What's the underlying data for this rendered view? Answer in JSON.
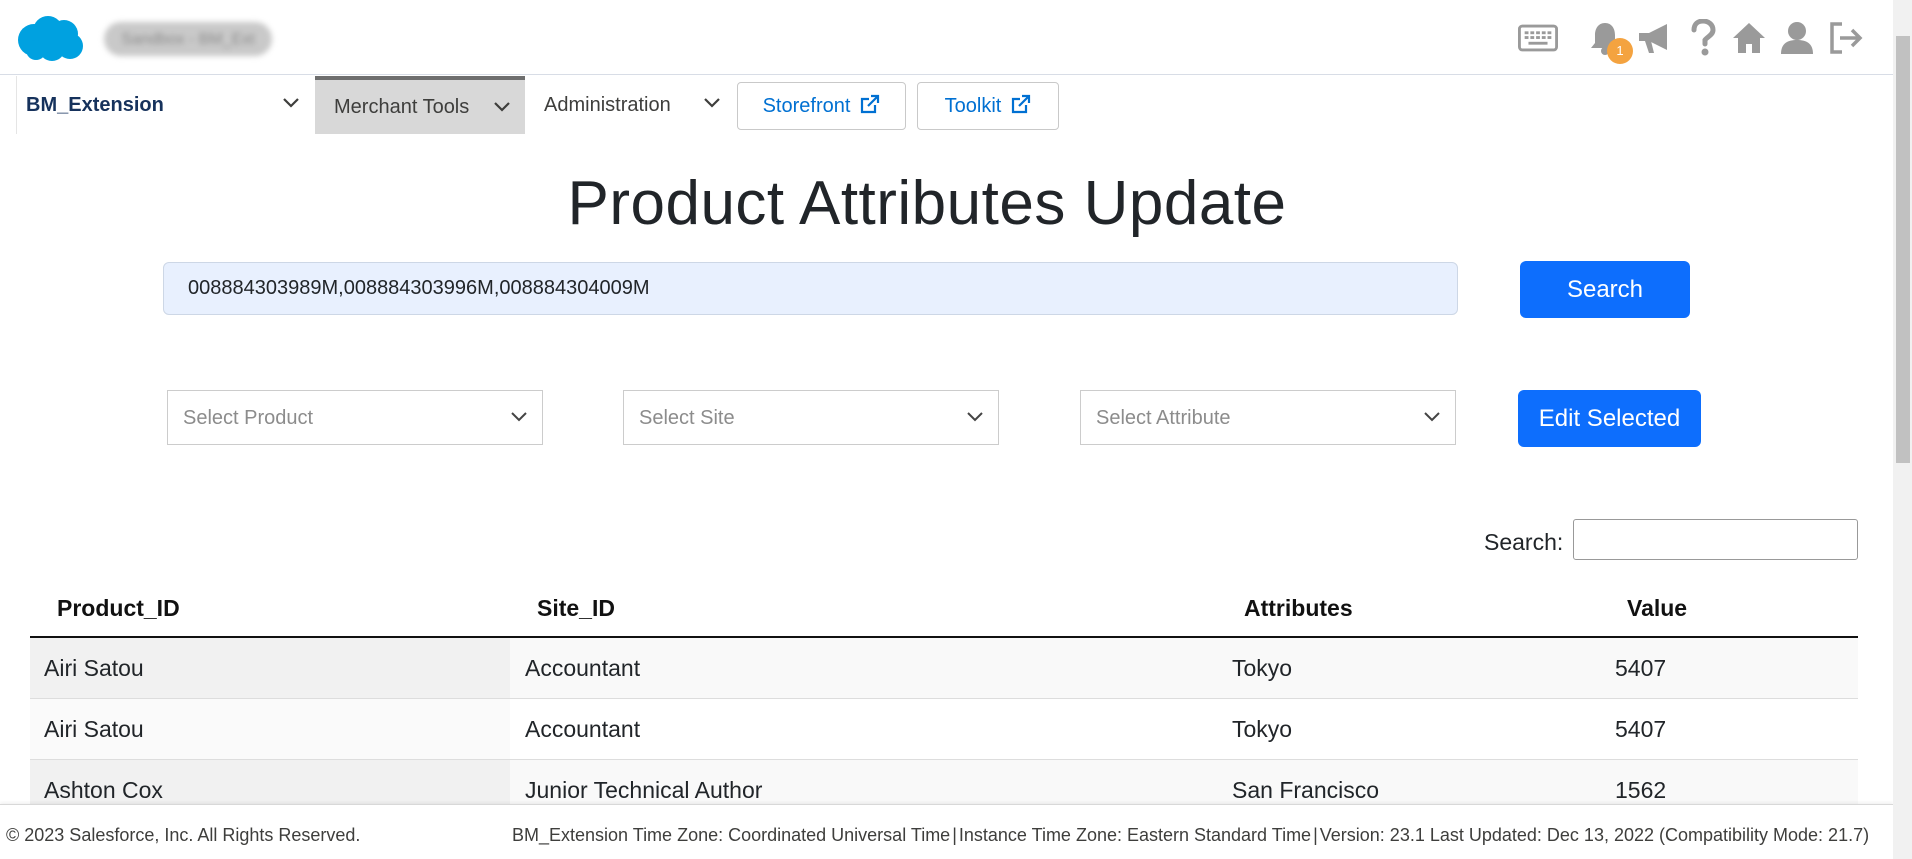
{
  "header": {
    "org_name": "Sandbox - BM_Ext",
    "notification_count": "1",
    "icons": [
      "salesforce-cloud-logo",
      "keyboard-icon",
      "bell-icon",
      "megaphone-icon",
      "help-icon",
      "home-icon",
      "user-icon",
      "logout-icon"
    ]
  },
  "nav": {
    "site_selector": "BM_Extension",
    "tabs": [
      {
        "label": "Merchant Tools",
        "active": true
      },
      {
        "label": "Administration",
        "active": false
      }
    ],
    "buttons": [
      {
        "label": "Storefront"
      },
      {
        "label": "Toolkit"
      }
    ]
  },
  "main": {
    "title": "Product Attributes Update",
    "id_input_value": "008884303989M,008884303996M,008884304009M",
    "search_button": "Search",
    "selects": [
      {
        "placeholder": "Select Product"
      },
      {
        "placeholder": "Select Site"
      },
      {
        "placeholder": "Select Attribute"
      }
    ],
    "edit_button": "Edit Selected",
    "table_search_label": "Search:",
    "table_search_value": ""
  },
  "table": {
    "headers": [
      "Product_ID",
      "Site_ID",
      "Attributes",
      "Value"
    ],
    "rows": [
      [
        "Airi Satou",
        "Accountant",
        "Tokyo",
        "5407"
      ],
      [
        "Airi Satou",
        "Accountant",
        "Tokyo",
        "5407"
      ],
      [
        "Ashton Cox",
        "Junior Technical Author",
        "San Francisco",
        "1562"
      ]
    ]
  },
  "footer": {
    "copyright": "© 2023 Salesforce, Inc. All Rights Reserved.",
    "bm_timezone": "BM_Extension Time Zone: Coordinated Universal Time",
    "instance_timezone": "Instance Time Zone: Eastern Standard Time",
    "version": "Version: 23.1 Last Updated: Dec 13, 2022 (Compatibility Mode: 21.7)",
    "separator": "|"
  },
  "colors": {
    "primary": "#0d6efd",
    "brand": "#00a1e0",
    "link": "#0070d2",
    "badge": "#f4a340",
    "icon_gray": "#9a9a9a"
  }
}
